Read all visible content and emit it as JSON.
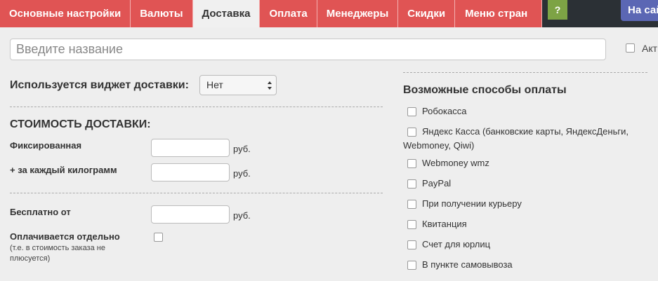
{
  "tabs": [
    {
      "label": "Основные настройки",
      "active": false
    },
    {
      "label": "Валюты",
      "active": false
    },
    {
      "label": "Доставка",
      "active": true
    },
    {
      "label": "Оплата",
      "active": false
    },
    {
      "label": "Менеджеры",
      "active": false
    },
    {
      "label": "Скидки",
      "active": false
    },
    {
      "label": "Меню стран",
      "active": false
    }
  ],
  "help_label": "?",
  "site_button_label": "На сай",
  "name_input": {
    "placeholder": "Введите название",
    "value": ""
  },
  "active_label": "Акт",
  "widget": {
    "label": "Используется виджет доставки:",
    "selected": "Нет"
  },
  "cost_section": {
    "title": "СТОИМОСТЬ ДОСТАВКИ:",
    "fixed_label": "Фиксированная",
    "per_kg_label": "+ за каждый килограмм",
    "unit": "руб."
  },
  "free_from_label": "Бесплатно от",
  "separate": {
    "label": "Оплачивается отдельно",
    "note": "(т.е. в стоимость заказа не плюсуется)"
  },
  "payment": {
    "title": "Возможные способы оплаты",
    "methods": [
      "Робокасса",
      "Яндекс Касса (банковские карты, ЯндексДеньги,",
      "Webmoney, Qiwi)",
      "Webmoney wmz",
      "PayPal",
      "При получении курьеру",
      "Квитанция",
      "Счет для юрлиц",
      "В пункте самовывоза"
    ]
  },
  "colors": {
    "tab": "#e05454",
    "help": "#7da345",
    "site": "#5b67b4",
    "bg": "#eeeeee"
  }
}
